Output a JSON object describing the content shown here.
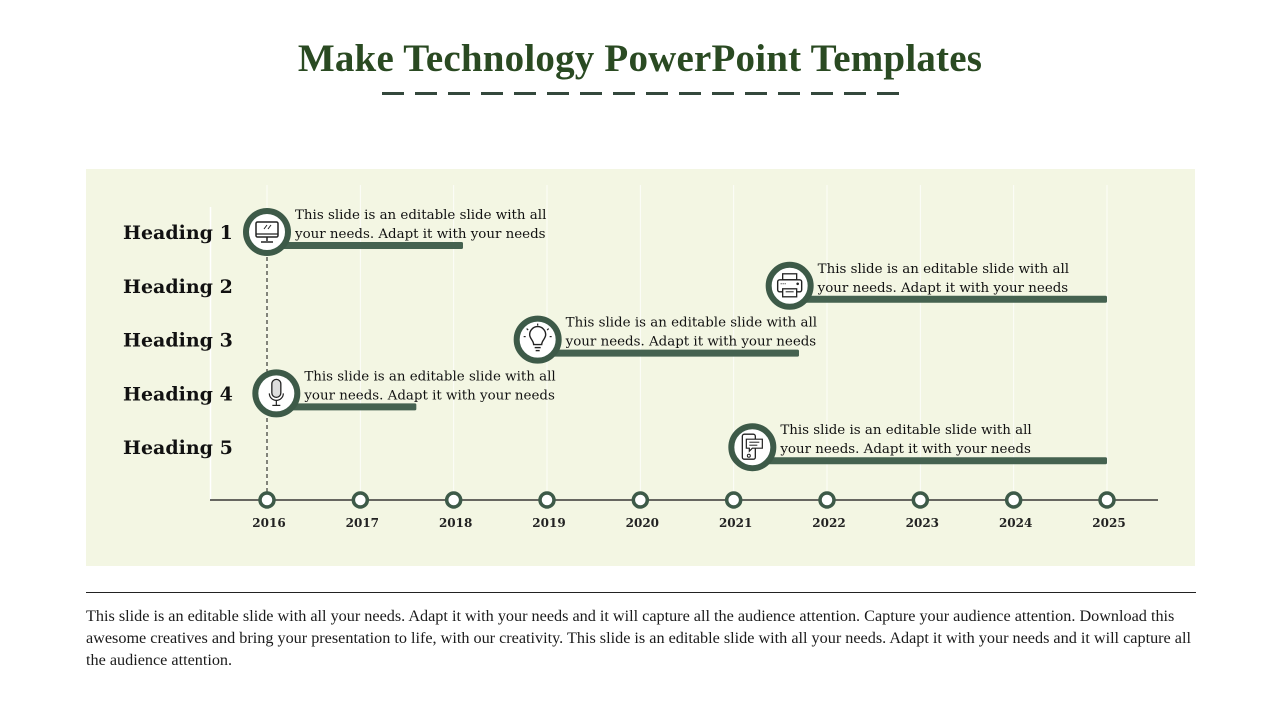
{
  "slide": {
    "title": "Make Technology PowerPoint Templates",
    "footer_paragraph": "This slide is an editable slide with all your needs.  Adapt it with your needs and it will capture all the audience attention. Capture your audience attention. Download this awesome creatives and bring your presentation to life, with our creativity. This slide is an editable slide with all your needs. Adapt it with your needs and it will capture all the audience attention."
  },
  "colors": {
    "title": "#2a4a22",
    "accent": "#456250",
    "panel_bg": "#f3f6e3",
    "ring": "#3d5a48"
  },
  "chart_data": {
    "type": "bar",
    "orientation": "horizontal-timeline",
    "title": "",
    "xlabel": "",
    "ylabel": "",
    "x_ticks": [
      2016,
      2017,
      2018,
      2019,
      2020,
      2021,
      2022,
      2023,
      2024,
      2025
    ],
    "xlim": [
      2016,
      2025
    ],
    "grid": "vertical-faint",
    "categories": [
      "Heading 1",
      "Heading 2",
      "Heading 3",
      "Heading 4",
      "Heading 5"
    ],
    "series": [
      {
        "name": "Heading 1",
        "start": 2016.0,
        "end": 2018.1,
        "icon": "monitor-icon",
        "label": [
          "This slide is an editable slide with all",
          "your needs. Adapt it with your needs"
        ]
      },
      {
        "name": "Heading 2",
        "start": 2021.6,
        "end": 2025.0,
        "icon": "printer-icon",
        "label": [
          "This slide is an editable slide with all",
          "your needs. Adapt it with your needs"
        ]
      },
      {
        "name": "Heading 3",
        "start": 2018.9,
        "end": 2021.7,
        "icon": "lightbulb-icon",
        "label": [
          "This slide is an editable slide with all",
          "your needs. Adapt it with your needs"
        ]
      },
      {
        "name": "Heading 4",
        "start": 2016.1,
        "end": 2017.6,
        "icon": "microphone-icon",
        "label": [
          "This slide is an editable slide with all",
          "your needs. Adapt it with your needs"
        ]
      },
      {
        "name": "Heading 5",
        "start": 2021.2,
        "end": 2025.0,
        "icon": "mobile-chat-icon",
        "label": [
          "This slide is an editable slide with all",
          "your needs. Adapt it with your needs"
        ]
      }
    ],
    "marker_line": {
      "x": 2016,
      "style": "dashed"
    }
  }
}
